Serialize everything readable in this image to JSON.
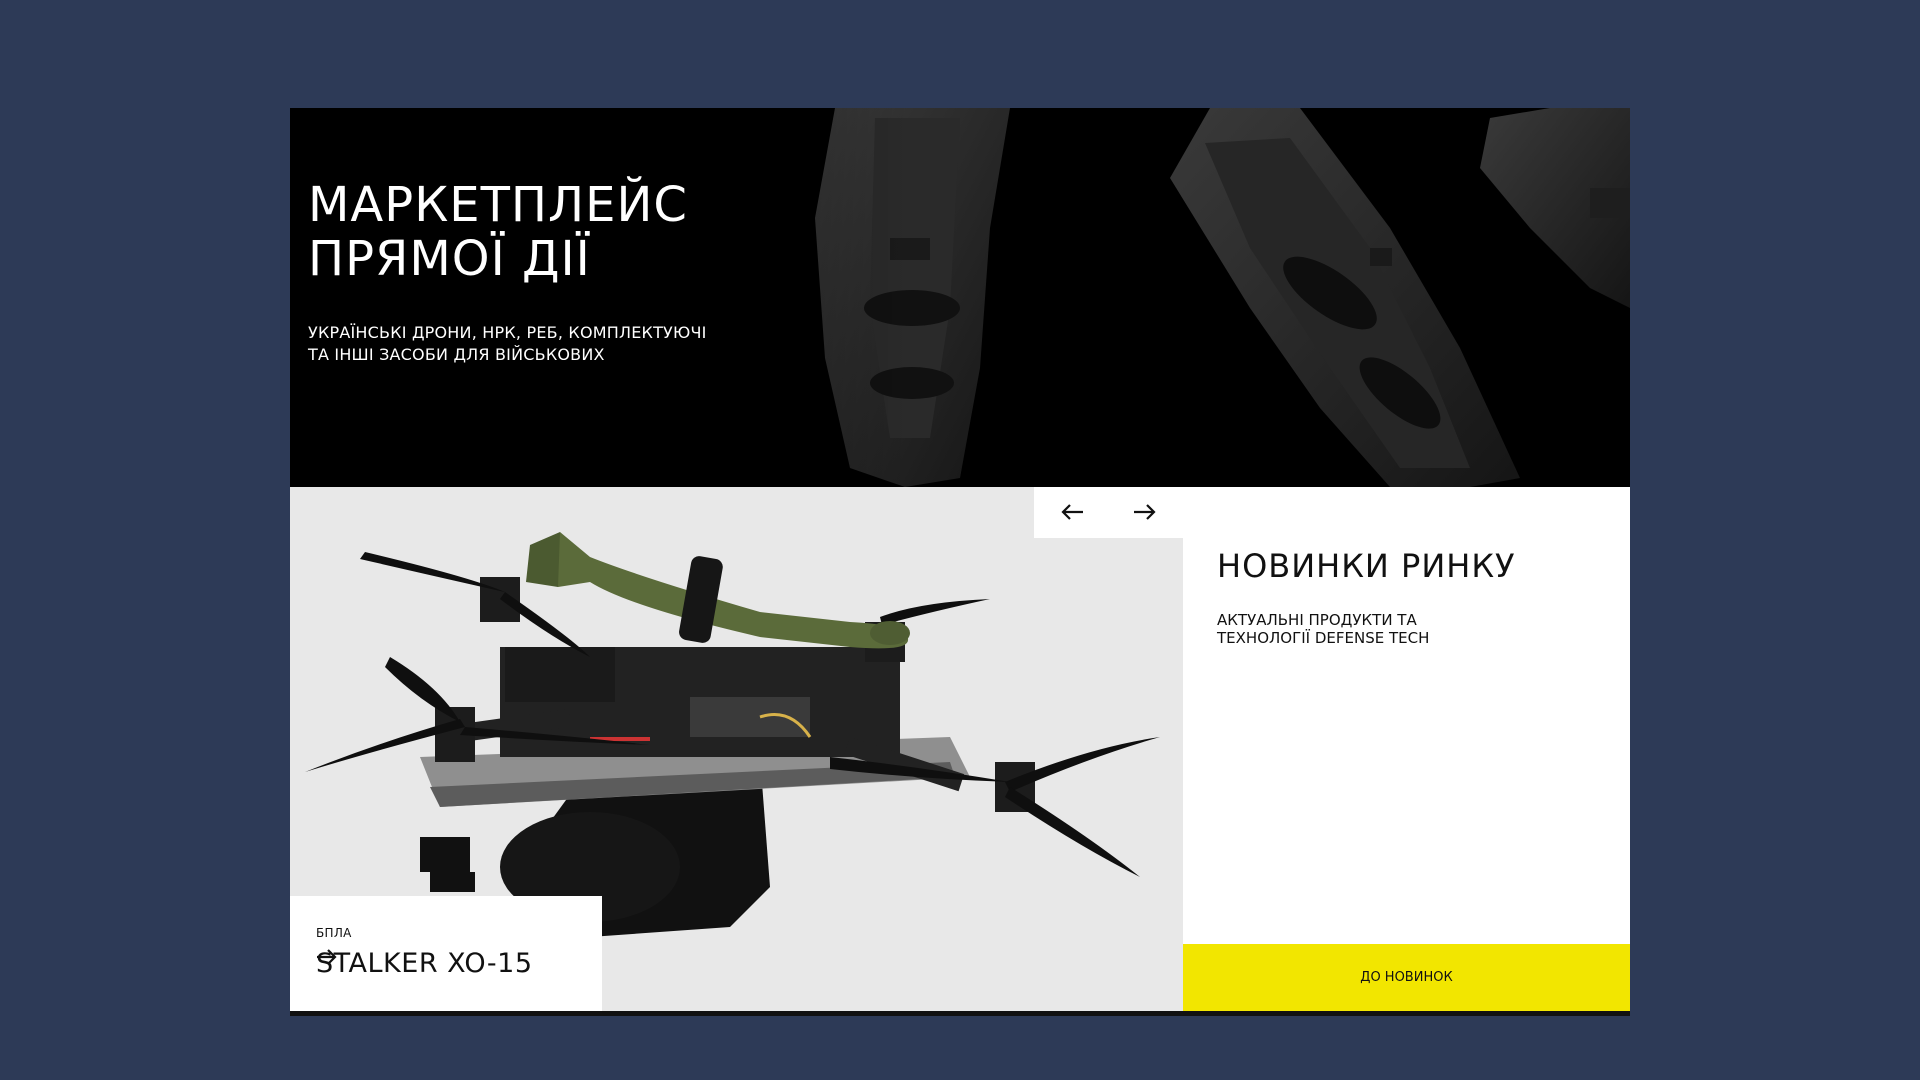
{
  "hero": {
    "title_line1": "МАРКЕТПЛЕЙС",
    "title_line2": "ПРЯМОЇ ДІЇ",
    "subtitle_line1": "УКРАЇНСЬКІ ДРОНИ, НРК, РЕБ, КОМПЛЕКТУЮЧІ",
    "subtitle_line2": "ТА ІНШІ ЗАСОБИ ДЛЯ ВІЙСЬКОВИХ"
  },
  "product": {
    "category": "БПЛА",
    "name": "STALKER XO-15"
  },
  "news": {
    "title": "НОВИНКИ РИНКУ",
    "subtitle_line1": "АКТУАЛЬНІ ПРОДУКТИ ТА",
    "subtitle_line2": "ТЕХНОЛОГІЇ DEFENSE TECH",
    "button_label": "ДО НОВИНОК"
  },
  "icons": {
    "prev": "arrow-left-icon",
    "next": "arrow-right-icon",
    "product_link": "arrow-right-icon"
  },
  "colors": {
    "page_background": "#2d3a57",
    "accent_yellow": "#f2e600",
    "hero_background": "#000000"
  }
}
